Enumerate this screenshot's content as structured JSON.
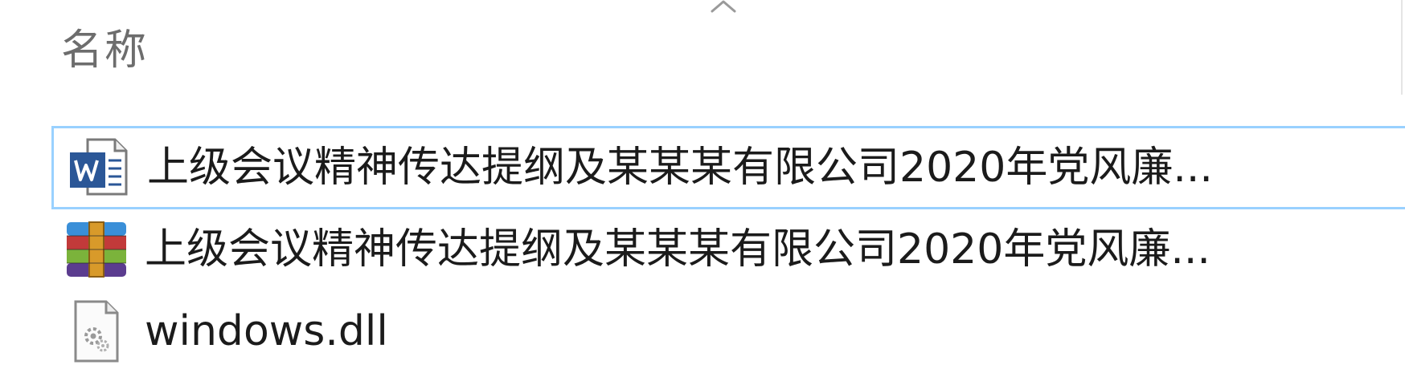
{
  "header": {
    "name_column_label": "名称",
    "sort_direction": "ascending"
  },
  "files": [
    {
      "name": "上级会议精神传达提纲及某某某有限公司2020年党风廉...",
      "icon": "word-document-icon",
      "selected": true
    },
    {
      "name": "上级会议精神传达提纲及某某某有限公司2020年党风廉...",
      "icon": "winrar-archive-icon",
      "selected": false
    },
    {
      "name": "windows.dll",
      "icon": "dll-file-icon",
      "selected": false
    }
  ],
  "colors": {
    "selection_border": "#99d1ff",
    "header_text": "#6d6d6d",
    "file_text": "#1b1b1b",
    "word_blue": "#2b5797"
  }
}
